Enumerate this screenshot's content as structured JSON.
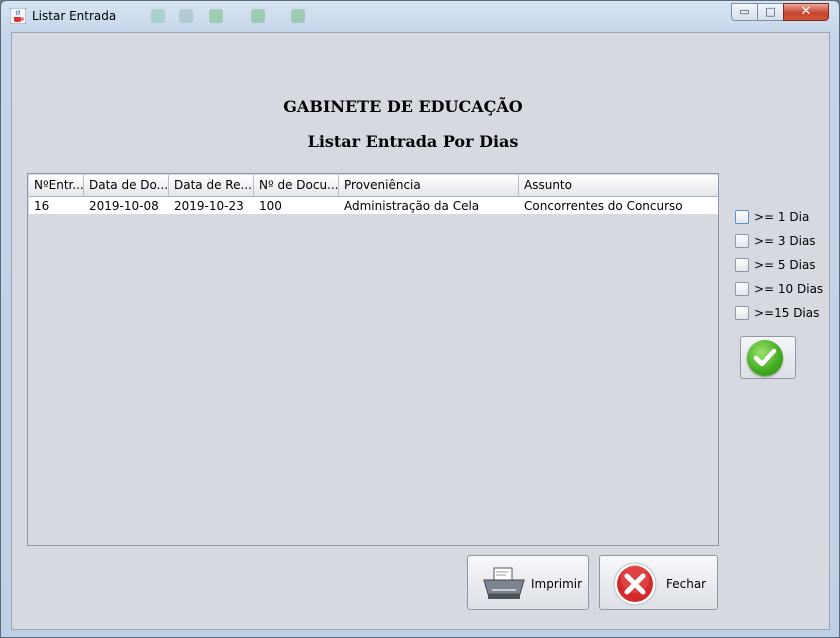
{
  "window": {
    "title": "Listar Entrada",
    "controls": {
      "minimize": "▭",
      "maximize": "□",
      "close": "✕"
    }
  },
  "header": {
    "line1": "GABINETE DE EDUCAÇÃO",
    "line2": "Listar Entrada Por Dias"
  },
  "table": {
    "columns": [
      "NºEntr...",
      "Data de Do...",
      "Data de Re...",
      "Nº de Docu...",
      "Proveniência",
      "Assunto"
    ],
    "rows": [
      [
        "16",
        "2019-10-08",
        "2019-10-23",
        "100",
        "Administração da Cela",
        "Concorrentes do Concurso"
      ]
    ]
  },
  "filters": [
    {
      "label": ">= 1 Dia",
      "checked": false
    },
    {
      "label": ">= 3 Dias",
      "checked": false
    },
    {
      "label": ">= 5 Dias",
      "checked": false
    },
    {
      "label": ">= 10 Dias",
      "checked": false
    },
    {
      "label": ">=15 Dias",
      "checked": false
    }
  ],
  "buttons": {
    "confirm_icon": "green-check-icon",
    "print_label": "Imprimir",
    "print_icon": "printer-icon",
    "close_label": "Fechar",
    "close_icon": "red-x-icon"
  }
}
